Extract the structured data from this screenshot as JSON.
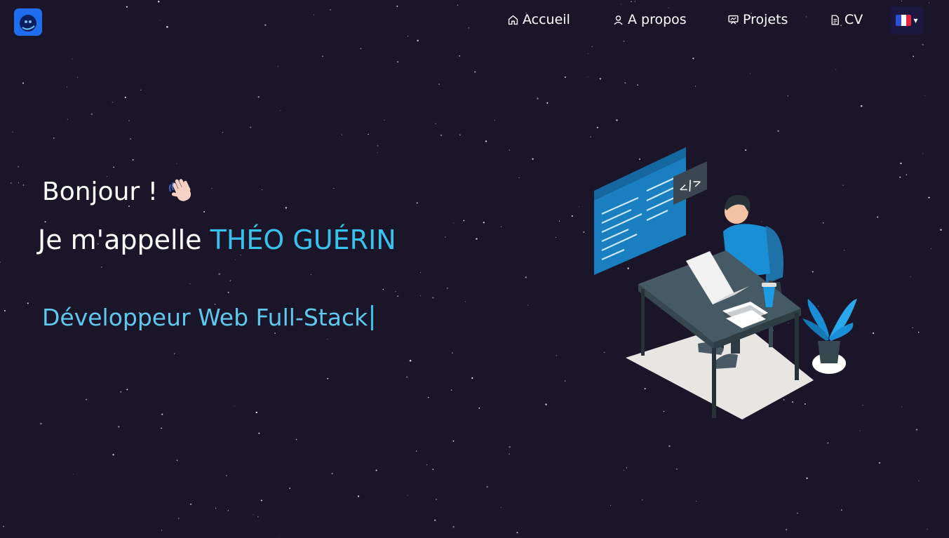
{
  "nav": {
    "items": [
      {
        "label": "Accueil",
        "icon": "home-icon"
      },
      {
        "label": "A propos",
        "icon": "user-icon"
      },
      {
        "label": "Projets",
        "icon": "presentation-icon"
      },
      {
        "label": "CV",
        "icon": "document-icon"
      }
    ],
    "language": {
      "flag": "france-flag-icon",
      "caret": "▾"
    }
  },
  "hero": {
    "greeting": "Bonjour !",
    "name_prefix": "Je m'appelle ",
    "name": "THÉO GUÉRIN",
    "role": "Développeur Web Full-Stack"
  },
  "colors": {
    "background": "#1b1529",
    "accent": "#38c2ee",
    "logo": "#1f6ef0"
  }
}
